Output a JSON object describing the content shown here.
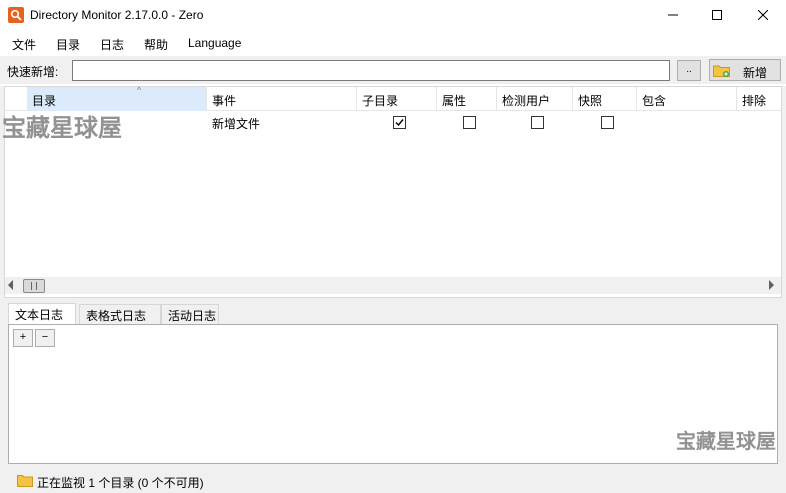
{
  "window": {
    "title": "Directory Monitor 2.17.0.0 - Zero"
  },
  "menu": {
    "items": [
      "文件",
      "目录",
      "日志",
      "帮助",
      "Language"
    ]
  },
  "quick_add": {
    "label": "快速新增:",
    "value": "",
    "browse_label": "..",
    "new_label": "新增"
  },
  "grid": {
    "columns": [
      "目录",
      "事件",
      "子目录",
      "属性",
      "检测用户",
      "快照",
      "包含",
      "排除"
    ],
    "rows": [
      {
        "directory": "",
        "event": "新增文件",
        "subdirectory": true,
        "attributes": false,
        "detect_user": false,
        "snapshot": false,
        "include": "",
        "exclude": ""
      }
    ]
  },
  "log": {
    "tabs": [
      "文本日志",
      "表格式日志",
      "活动日志"
    ],
    "active_tab": "文本日志",
    "expand_label": "+",
    "collapse_label": "−"
  },
  "status": {
    "text": "正在监视 1 个目录 (0 个不可用)"
  },
  "watermark": {
    "text": "宝藏星球屋"
  }
}
